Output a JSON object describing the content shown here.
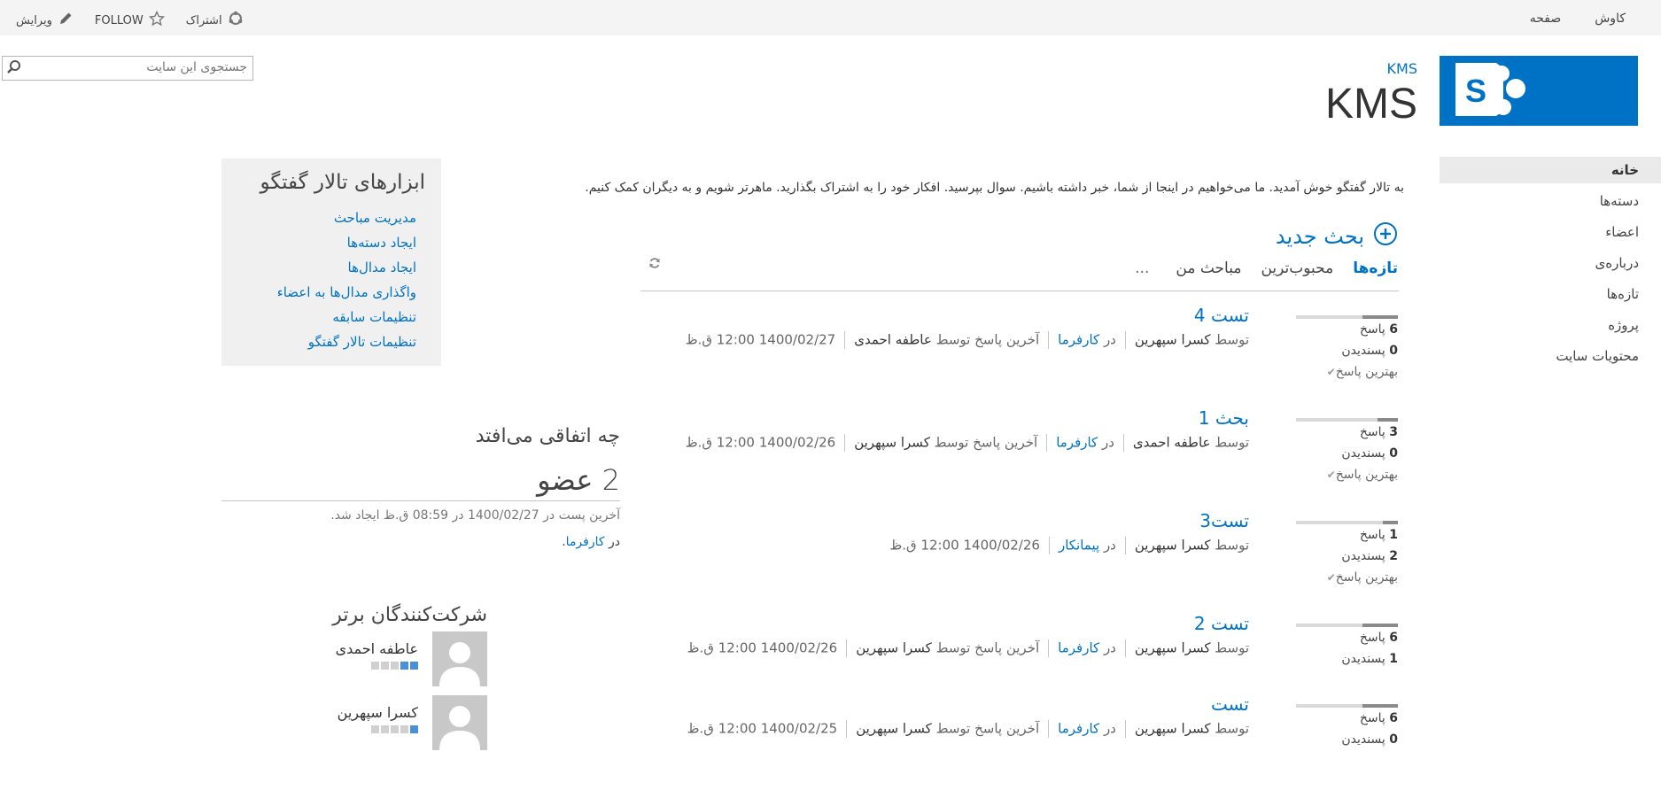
{
  "suitebar": {
    "right_items": [
      "کاوش",
      "صفحه"
    ],
    "share_label": "اشتراک",
    "follow_label": "FOLLOW",
    "edit_label": "ویرایش"
  },
  "header": {
    "breadcrumb": "KMS",
    "title": "KMS",
    "search_placeholder": "جستجوی این سایت"
  },
  "quicklaunch": {
    "items": [
      "خانه",
      "دسته‌ها",
      "اعضاء",
      "درباره‌ی",
      "تازه‌ها",
      "پروژه",
      "محتویات سایت"
    ]
  },
  "main": {
    "welcome": "به تالار گفتگو خوش آمدید. ما می‌خواهیم در اینجا از شما، خبر داشته باشیم. سوال بپرسید. افکار خود را به اشتراک بگذارید. ماهرتر شویم و به دیگران کمک کنیم.",
    "new_discussion": "بحث جدید",
    "tabs": [
      "تازه‌ها",
      "محبوب‌ترین",
      "مباحث من"
    ],
    "more": "...",
    "labels": {
      "replies": "پاسخ",
      "likes": "پسندیدن",
      "best_reply": "بهترین پاسخ",
      "by": "توسط",
      "in": "در",
      "last_reply_by": "آخرین پاسخ توسط"
    },
    "posts": [
      {
        "title": "تست 4",
        "author": "کسرا سپهرین",
        "category": "کارفرما",
        "last_by": "عاطفه احمدی",
        "date": "1400/02/27 12:00 ق.ظ",
        "replies": "6",
        "likes": "0",
        "best": true,
        "bar": 0.35
      },
      {
        "title": "بحث 1",
        "author": "عاطفه احمدی",
        "category": "کارفرما",
        "last_by": "کسرا سپهرین",
        "date": "1400/02/26 12:00 ق.ظ",
        "replies": "3",
        "likes": "0",
        "best": true,
        "bar": 0.2
      },
      {
        "title": "تست3",
        "author": "کسرا سپهرین",
        "category": "پیمانکار",
        "last_by": "",
        "date": "1400/02/26 12:00 ق.ظ",
        "replies": "1",
        "likes": "2",
        "best": true,
        "bar": 0.15
      },
      {
        "title": "تست 2",
        "author": "کسرا سپهرین",
        "category": "کارفرما",
        "last_by": "کسرا سپهرین",
        "date": "1400/02/26 12:00 ق.ظ",
        "replies": "6",
        "likes": "1",
        "best": false,
        "bar": 0.35
      },
      {
        "title": "تست",
        "author": "کسرا سپهرین",
        "category": "کارفرما",
        "last_by": "کسرا سپهرین",
        "date": "1400/02/25 12:00 ق.ظ",
        "replies": "6",
        "likes": "0",
        "best": false,
        "bar": 0.35
      }
    ]
  },
  "tools": {
    "title": "ابزارهای تالار گفتگو",
    "links": [
      "مدیریت مباحث",
      "ایجاد دسته‌ها",
      "ایجاد مدال‌ها",
      "واگذاری مدال‌ها به اعضاء",
      "تنظیمات سابقه",
      "تنظیمات تالار گفتگو"
    ]
  },
  "happening": {
    "title": "چه اتفاقی می‌افتد",
    "members": "2 عضو",
    "last_post": "آخرین پست در 1400/02/27 در 08:59 ق.ظ ایجاد شد.",
    "in_prefix": "در",
    "in_category": "کارفرما"
  },
  "top_contributors": {
    "title": "شرکت‌کنندگان برتر",
    "people": [
      {
        "name": "عاطفه احمدی",
        "rank": 2
      },
      {
        "name": "کسرا سپهرین",
        "rank": 1
      }
    ]
  },
  "colors": {
    "accent": "#0072c6",
    "suitebar": "#f4f4f4",
    "panel": "#f0f0f0"
  }
}
